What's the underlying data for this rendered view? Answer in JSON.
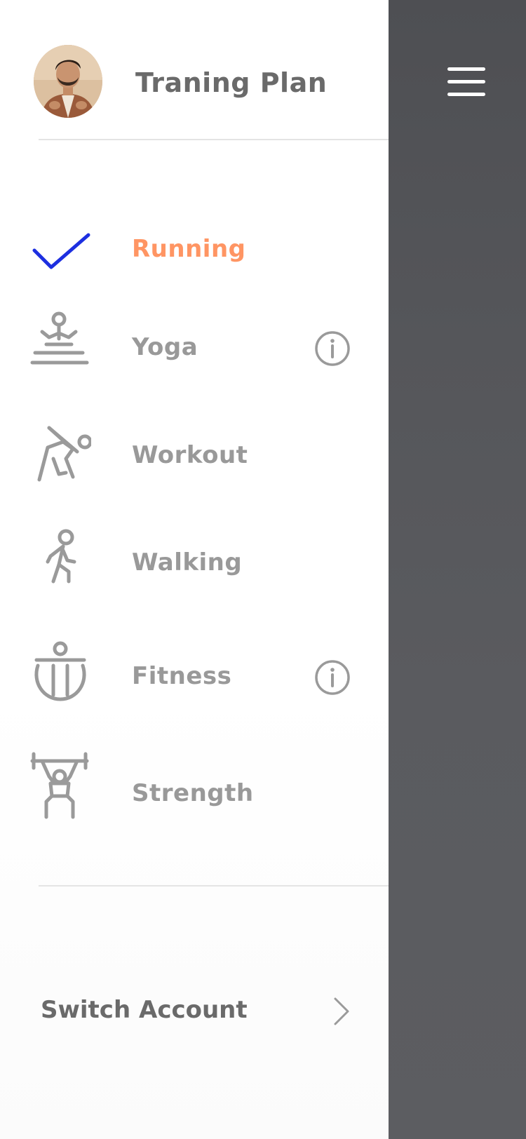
{
  "header": {
    "title": "Traning Plan",
    "avatar_icon": "user-avatar"
  },
  "menu": {
    "items": [
      {
        "label": "Running",
        "icon": "checkmark-icon",
        "active": true,
        "info": false
      },
      {
        "label": "Yoga",
        "icon": "yoga-icon",
        "active": false,
        "info": true
      },
      {
        "label": "Workout",
        "icon": "workout-icon",
        "active": false,
        "info": false
      },
      {
        "label": "Walking",
        "icon": "walking-icon",
        "active": false,
        "info": false
      },
      {
        "label": "Fitness",
        "icon": "fitness-icon",
        "active": false,
        "info": true
      },
      {
        "label": "Strength",
        "icon": "strength-icon",
        "active": false,
        "info": false
      }
    ]
  },
  "footer": {
    "switch_account_label": "Switch Account"
  },
  "colors": {
    "active_text": "#ff9563",
    "checkmark": "#1d2fe0",
    "inactive_text": "#999999",
    "title_text": "#6a6a6a",
    "overlay": "#55565a"
  }
}
